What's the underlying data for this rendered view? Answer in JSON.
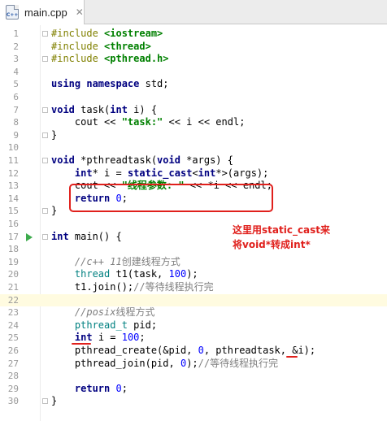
{
  "tab": {
    "filename": "main.cpp",
    "icon": "cpp-file-icon",
    "icon_text": "C++",
    "close_glyph": "✕"
  },
  "colors": {
    "annotation": "#e0201c",
    "keyword": "#000080",
    "string": "#008000",
    "number": "#0000ff",
    "comment": "#808080",
    "run_icon": "#3dab4d"
  },
  "annotation": {
    "line1": "这里用static_cast来",
    "line2": "将void*转成int*"
  },
  "lines": [
    {
      "n": "1"
    },
    {
      "n": "2"
    },
    {
      "n": "3"
    },
    {
      "n": "4"
    },
    {
      "n": "5"
    },
    {
      "n": "6"
    },
    {
      "n": "7"
    },
    {
      "n": "8"
    },
    {
      "n": "9"
    },
    {
      "n": "10"
    },
    {
      "n": "11"
    },
    {
      "n": "12"
    },
    {
      "n": "13"
    },
    {
      "n": "14"
    },
    {
      "n": "15"
    },
    {
      "n": "16"
    },
    {
      "n": "17"
    },
    {
      "n": "18"
    },
    {
      "n": "19"
    },
    {
      "n": "20"
    },
    {
      "n": "21"
    },
    {
      "n": "22"
    },
    {
      "n": "23"
    },
    {
      "n": "24"
    },
    {
      "n": "25"
    },
    {
      "n": "26"
    },
    {
      "n": "27"
    },
    {
      "n": "28"
    },
    {
      "n": "29"
    },
    {
      "n": "30"
    }
  ],
  "code": {
    "l1": {
      "a": "#include ",
      "b": "<iostream>"
    },
    "l2": {
      "a": "#include ",
      "b": "<thread>"
    },
    "l3": {
      "a": "#include ",
      "b": "<pthread.h>"
    },
    "l5": {
      "a": "using namespace ",
      "b": "std;"
    },
    "l7": {
      "a": "void ",
      "b": "task(",
      "c": "int ",
      "d": "i) {"
    },
    "l8": {
      "a": "    cout << ",
      "b": "\"task:\"",
      "c": " << i << endl;"
    },
    "l9": {
      "a": "}"
    },
    "l11": {
      "a": "void ",
      "b": "*pthreadtask(",
      "c": "void ",
      "d": "*args) {"
    },
    "l12": {
      "a": "    ",
      "b": "int",
      "c": "* i = ",
      "d": "static_cast",
      "e": "<",
      "f": "int",
      "g": "*>(args);"
    },
    "l13": {
      "a": "    cout << ",
      "b": "\"线程参数: \"",
      "c": " << *i << endl;"
    },
    "l14": {
      "a": "    ",
      "b": "return ",
      "c": "0",
      "d": ";"
    },
    "l15": {
      "a": "}"
    },
    "l17": {
      "a": "int ",
      "b": "main() {"
    },
    "l19": {
      "a": "    ",
      "b": "//c++ 11",
      "c": "创建线程方式"
    },
    "l20": {
      "a": "    ",
      "b": "thread ",
      "c": "t1(task, ",
      "d": "100",
      "e": ");"
    },
    "l21": {
      "a": "    t1.join();",
      "b": "//等待线程执行完"
    },
    "l23": {
      "a": "    ",
      "b": "//posix",
      "c": "线程方式"
    },
    "l24": {
      "a": "    ",
      "b": "pthread_t ",
      "c": "pid;"
    },
    "l25": {
      "a": "    ",
      "b": "int ",
      "c": "i = ",
      "d": "100",
      "e": ";"
    },
    "l26": {
      "a": "    pthread_create(&pid, ",
      "b": "0",
      "c": ", pthreadtask, &i);"
    },
    "l27": {
      "a": "    pthread_join(pid, ",
      "b": "0",
      "c": ");",
      "d": "//等待线程执行完"
    },
    "l29": {
      "a": "    ",
      "b": "return ",
      "c": "0",
      "d": ";"
    },
    "l30": {
      "a": "}"
    }
  }
}
